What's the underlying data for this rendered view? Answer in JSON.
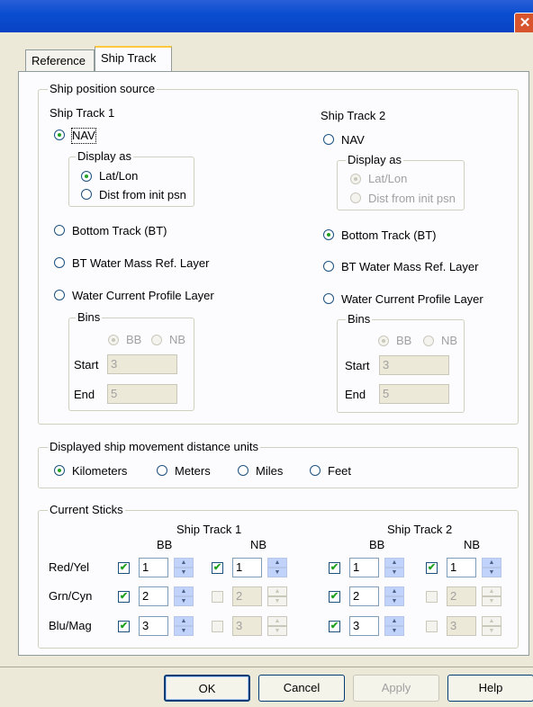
{
  "window": {
    "close_glyph": "✕"
  },
  "tabs": [
    {
      "label": "Reference"
    },
    {
      "label": "Ship Track"
    }
  ],
  "ship_position": {
    "legend": "Ship position source",
    "track1": {
      "title": "Ship Track 1",
      "nav_label": "NAV",
      "display_as_legend": "Display as",
      "latlon_label": "Lat/Lon",
      "dist_label": "Dist from init psn",
      "bt_label": "Bottom Track (BT)",
      "btwm_label": "BT Water Mass Ref. Layer",
      "wcp_label": "Water Current Profile Layer",
      "bins_legend": "Bins",
      "bb_label": "BB",
      "nb_label": "NB",
      "start_label": "Start",
      "start_value": "3",
      "end_label": "End",
      "end_value": "5"
    },
    "track2": {
      "title": "Ship Track 2",
      "nav_label": "NAV",
      "display_as_legend": "Display as",
      "latlon_label": "Lat/Lon",
      "dist_label": "Dist from init psn",
      "bt_label": "Bottom Track (BT)",
      "btwm_label": "BT Water Mass Ref. Layer",
      "wcp_label": "Water Current Profile Layer",
      "bins_legend": "Bins",
      "bb_label": "BB",
      "nb_label": "NB",
      "start_label": "Start",
      "start_value": "3",
      "end_label": "End",
      "end_value": "5"
    }
  },
  "units": {
    "legend": "Displayed ship movement distance units",
    "options": [
      "Kilometers",
      "Meters",
      "Miles",
      "Feet"
    ]
  },
  "sticks": {
    "legend": "Current Sticks",
    "track1_title": "Ship Track 1",
    "track2_title": "Ship Track 2",
    "bb": "BB",
    "nb": "NB",
    "rows": [
      {
        "label": "Red/Yel",
        "t1bb": "1",
        "t1nb": "1",
        "t2bb": "1",
        "t2nb": "1"
      },
      {
        "label": "Grn/Cyn",
        "t1bb": "2",
        "t1nb": "2",
        "t2bb": "2",
        "t2nb": "2"
      },
      {
        "label": "Blu/Mag",
        "t1bb": "3",
        "t1nb": "3",
        "t2bb": "3",
        "t2nb": "3"
      }
    ]
  },
  "buttons": {
    "ok": "OK",
    "cancel": "Cancel",
    "apply": "Apply",
    "help": "Help"
  },
  "colors": {
    "titlebar": "#0b4ed0",
    "close": "#d8542d",
    "dialog_bg": "#ece9d8",
    "panel_bg": "#fcfcfe"
  }
}
